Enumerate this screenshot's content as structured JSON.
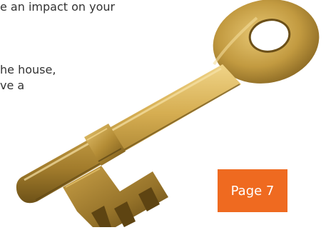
{
  "body_text": {
    "line1": "e an impact on your",
    "line2": "he house,",
    "line3": "ve a"
  },
  "page_badge": {
    "label": "Page 7",
    "color": "#ef6a20"
  },
  "illustration": {
    "subject": "brass-key",
    "colors": {
      "brass_light": "#e6c46c",
      "brass_mid": "#c8a146",
      "brass_dark": "#8a6a22",
      "shadow": "#5b4414"
    }
  }
}
